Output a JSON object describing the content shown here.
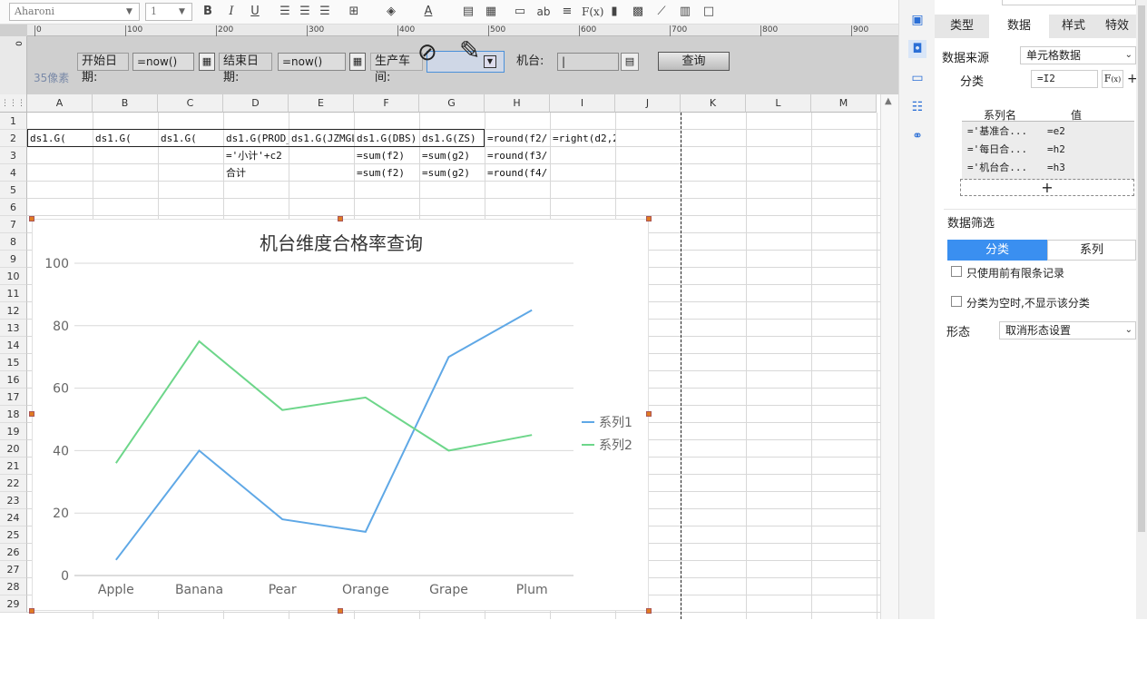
{
  "toolbar": {
    "font_name": "Aharoni",
    "font_size": "1",
    "bold": "B",
    "italic": "I",
    "underline": "U",
    "ab": "ab",
    "fx": "F(x)"
  },
  "ruler": {
    "ticks": [
      "0",
      "100",
      "200",
      "300",
      "400",
      "500",
      "600",
      "700",
      "800",
      "900"
    ],
    "vertical_zero": "0"
  },
  "form": {
    "start_label": "开始日期:",
    "start_value": "=now()",
    "end_label": "结束日期:",
    "end_value": "=now()",
    "workshop_label": "生产车间:",
    "machine_label": "机台:",
    "query_label": "查询",
    "pixel_note": "35像素"
  },
  "sheet": {
    "columns": [
      "A",
      "B",
      "C",
      "D",
      "E",
      "F",
      "G",
      "H",
      "I",
      "J",
      "K",
      "L",
      "M"
    ],
    "rows": [
      "1",
      "2",
      "3",
      "4",
      "5",
      "6",
      "7",
      "8",
      "9",
      "10",
      "11",
      "12",
      "13",
      "14",
      "15",
      "16",
      "17",
      "18",
      "19",
      "20",
      "21",
      "22",
      "23",
      "24",
      "25",
      "26",
      "27",
      "28",
      "29"
    ],
    "cells": {
      "A2": "ds1.G(",
      "B2": "ds1.G(",
      "C2": "ds1.G(",
      "D2": "ds1.G(PROD_",
      "E2": "ds1.G(JZMGL",
      "F2": "ds1.G(DBS)",
      "G2": "ds1.G(ZS)",
      "H2": "=round(f2/",
      "I2": "=right(d2,2",
      "D3": "='小计'+c2",
      "F3": "=sum(f2)",
      "G3": "=sum(g2)",
      "H3": "=round(f3/",
      "D4": "合计",
      "F4": "=sum(f2)",
      "G4": "=sum(g2)",
      "H4": "=round(f4/"
    }
  },
  "chart_data": {
    "type": "line",
    "title": "机台维度合格率查询",
    "categories": [
      "Apple",
      "Banana",
      "Pear",
      "Orange",
      "Grape",
      "Plum"
    ],
    "series": [
      {
        "name": "系列1",
        "color": "#5fa8e6",
        "values": [
          5,
          40,
          18,
          14,
          70,
          85
        ]
      },
      {
        "name": "系列2",
        "color": "#6dd68a",
        "values": [
          36,
          75,
          53,
          57,
          40,
          45
        ]
      }
    ],
    "y_ticks": [
      "0",
      "20",
      "40",
      "60",
      "80",
      "100"
    ],
    "ylim": [
      0,
      100
    ],
    "legend": "right",
    "grid": true
  },
  "panel": {
    "tabs": [
      "类型",
      "数据",
      "样式",
      "特效"
    ],
    "active_tab": "数据",
    "data_source_label": "数据来源",
    "data_source_value": "单元格数据",
    "category_label": "分类",
    "category_value": "=I2",
    "series_name_header": "系列名",
    "value_header": "值",
    "series_rows": [
      {
        "name": "='基准合...",
        "value": "=e2"
      },
      {
        "name": "='每日合...",
        "value": "=h2"
      },
      {
        "name": "='机台合...",
        "value": "=h3"
      }
    ],
    "add_symbol": "+",
    "filter_label": "数据筛选",
    "filter_tabs": [
      "分类",
      "系列"
    ],
    "option1": "只使用前有限条记录",
    "option2": "分类为空时,不显示该分类",
    "form_label": "形态",
    "form_value": "取消形态设置"
  }
}
